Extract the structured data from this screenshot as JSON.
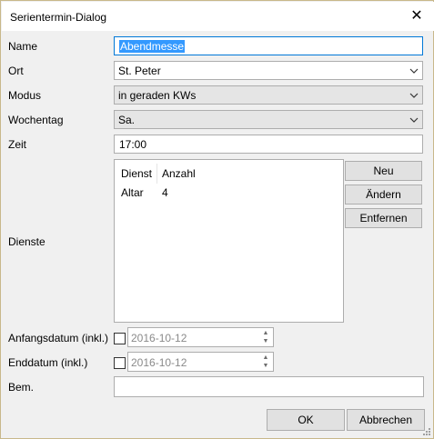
{
  "window": {
    "title": "Serientermin-Dialog"
  },
  "labels": {
    "name": "Name",
    "ort": "Ort",
    "modus": "Modus",
    "wochentag": "Wochentag",
    "zeit": "Zeit",
    "dienste": "Dienste",
    "anfangsdatum": "Anfangsdatum (inkl.)",
    "enddatum": "Enddatum (inkl.)",
    "bem": "Bem."
  },
  "fields": {
    "name_value": "Abendmesse",
    "ort_value": "St. Peter",
    "modus_value": "in geraden KWs",
    "wochentag_value": "Sa.",
    "zeit_value": "17:00",
    "anfangsdatum_value": "2016-10-12",
    "enddatum_value": "2016-10-12",
    "bem_value": ""
  },
  "dienste_table": {
    "columns": [
      "Dienst",
      "Anzahl"
    ],
    "rows": [
      {
        "dienst": "Altar",
        "anzahl": "4"
      }
    ]
  },
  "buttons": {
    "neu": "Neu",
    "aendern": "Ändern",
    "entfernen": "Entfernen",
    "ok": "OK",
    "abbrechen": "Abbrechen"
  },
  "checkboxes": {
    "anfangsdatum_checked": false,
    "enddatum_checked": false
  },
  "colors": {
    "selection": "#3399ff",
    "focus_border": "#0078d7",
    "dialog_bg": "#f0f0f0"
  },
  "icons": [
    "close-icon",
    "chevron-down-icon",
    "spin-up-icon",
    "spin-down-icon",
    "resize-grip-icon"
  ]
}
